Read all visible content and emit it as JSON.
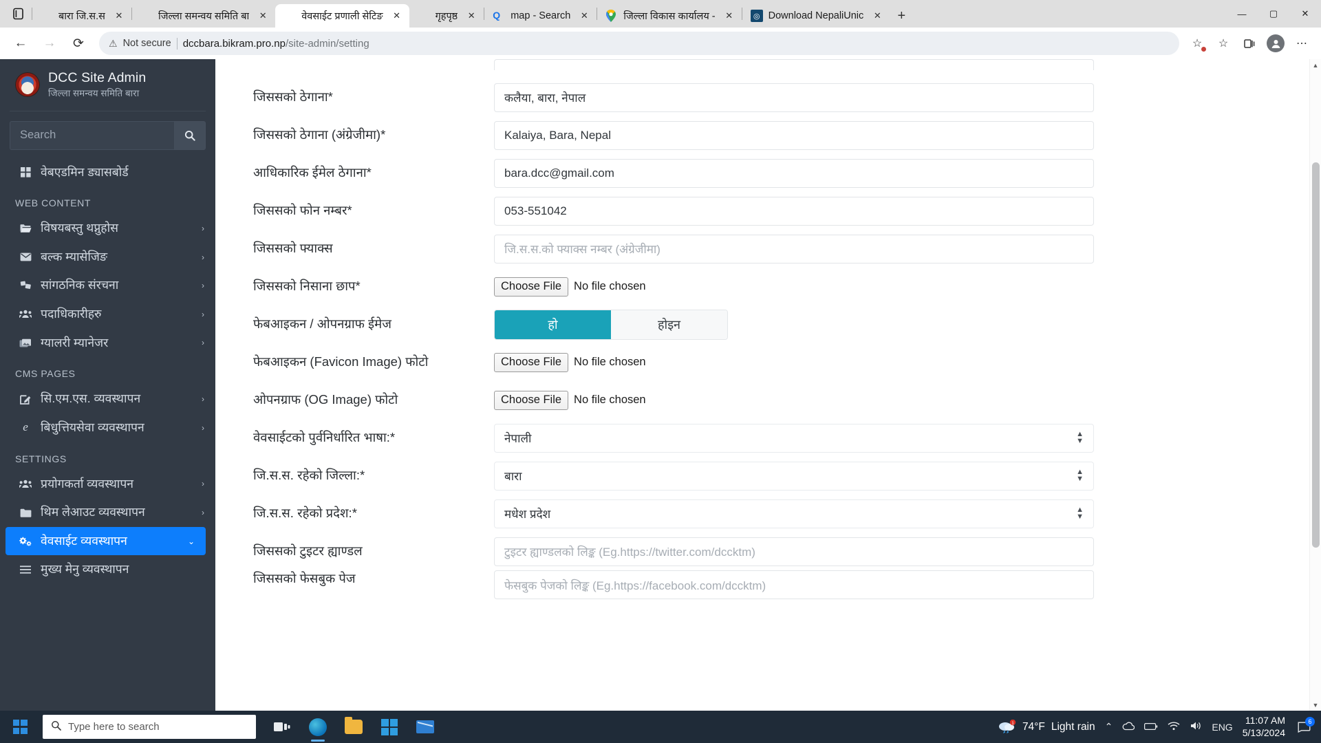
{
  "browser": {
    "tabs": [
      {
        "title": "बारा जि.स.स",
        "icon": "nepal-emblem-icon",
        "active": false
      },
      {
        "title": "जिल्ला समन्वय समिति बा",
        "icon": "nepal-emblem-icon",
        "active": false
      },
      {
        "title": "वेवसाईट प्रणाली सेटिङ",
        "icon": "nepal-emblem-icon",
        "active": true
      },
      {
        "title": "गृहपृष्ठ",
        "icon": "nepal-emblem-icon",
        "active": false
      },
      {
        "title": "map - Search",
        "icon": "bing-search-icon",
        "active": false
      },
      {
        "title": "जिल्ला विकास कार्यालय -",
        "icon": "google-maps-icon",
        "active": false
      },
      {
        "title": "Download NepaliUnic",
        "icon": "download-app-icon",
        "active": false
      }
    ],
    "new_tab_label": "+",
    "close_label": "✕",
    "window_controls": {
      "minimize": "—",
      "maximize": "▢",
      "close": "✕"
    },
    "nav": {
      "back": "←",
      "forward": "→",
      "refresh": "⟳"
    },
    "address": {
      "security_label": "Not secure",
      "url_host": "dccbara.bikram.pro.np",
      "url_path": "/site-admin/setting"
    },
    "toolbar_icons": [
      "add-to-favorites-icon",
      "favorites-icon",
      "collections-icon",
      "profile-icon",
      "settings-and-more-icon"
    ]
  },
  "sidebar": {
    "brand": {
      "title": "DCC Site Admin",
      "subtitle": "जिल्ला समन्वय समिति बारा",
      "logo": "nepal-emblem-logo"
    },
    "search": {
      "placeholder": "Search",
      "button_icon": "search-icon"
    },
    "dashboard": {
      "label": "वेबएडमिन ड्यासबोर्ड",
      "icon": "dashboard-grid-icon"
    },
    "sections": [
      {
        "title": "WEB CONTENT",
        "items": [
          {
            "label": "विषयबस्तु थप्नुहोस",
            "icon": "folder-open-icon",
            "chevron": "›"
          },
          {
            "label": "बल्क म्यासेजिङ",
            "icon": "envelope-icon",
            "chevron": "›"
          },
          {
            "label": "सांगठनिक संरचना",
            "icon": "sitemap-icon",
            "chevron": "›"
          },
          {
            "label": "पदाधिकारीहरु",
            "icon": "users-icon",
            "chevron": "›"
          },
          {
            "label": "ग्यालरी म्यानेजर",
            "icon": "images-icon",
            "chevron": "›"
          }
        ]
      },
      {
        "title": "CMS PAGES",
        "items": [
          {
            "label": "सि.एम.एस. व्यवस्थापन",
            "icon": "edit-square-icon",
            "chevron": "›"
          },
          {
            "label": "बिधुत्तियसेवा व्यवस्थापन",
            "icon": "internet-explorer-icon",
            "chevron": "›"
          }
        ]
      },
      {
        "title": "SETTINGS",
        "items": [
          {
            "label": "प्रयोगकर्ता व्यवस्थापन",
            "icon": "users-icon",
            "chevron": "›"
          },
          {
            "label": "थिम लेआउट व्यवस्थापन",
            "icon": "folder-icon",
            "chevron": "›"
          },
          {
            "label": "वेवसाईट व्यवस्थापन",
            "icon": "gears-icon",
            "chevron": "⌄",
            "active": true
          },
          {
            "label": "मुख्य मेनु व्यवस्थापन",
            "icon": "list-icon",
            "chevron": ""
          }
        ]
      }
    ],
    "active_color": "#0d7efc",
    "background_color": "#323a45"
  },
  "form": {
    "rows": [
      {
        "type": "input-cut",
        "label": "",
        "value": ""
      },
      {
        "type": "input",
        "label": "जिससको ठेगाना*",
        "value": "कलैया, बारा, नेपाल"
      },
      {
        "type": "input",
        "label": "जिससको ठेगाना (अंग्रेजीमा)*",
        "value": "Kalaiya, Bara, Nepal"
      },
      {
        "type": "input",
        "label": "आधिकारिक ईमेल ठेगाना*",
        "value": "bara.dcc@gmail.com"
      },
      {
        "type": "input",
        "label": "जिससको फोन नम्बर*",
        "value": "053-551042"
      },
      {
        "type": "input",
        "label": "जिससको फ्याक्स",
        "value": "",
        "placeholder": "जि.स.स.को फ्याक्स नम्बर (अंग्रेजीमा)"
      },
      {
        "type": "file",
        "label": "जिससको निसाना छाप*",
        "button": "Choose File",
        "status": "No file chosen"
      },
      {
        "type": "toggle",
        "label": "फेबआइकन / ओपनग्राफ ईमेज",
        "options": [
          "हो",
          "होइन"
        ],
        "selected": 0
      },
      {
        "type": "file",
        "label": "फेबआइकन (Favicon Image) फोटो",
        "button": "Choose File",
        "status": "No file chosen"
      },
      {
        "type": "file",
        "label": "ओपनग्राफ (OG Image) फोटो",
        "button": "Choose File",
        "status": "No file chosen"
      },
      {
        "type": "select",
        "label": "वेवसाईटको पुर्वनिर्धारित भाषा:*",
        "value": "नेपाली"
      },
      {
        "type": "select",
        "label": "जि.स.स. रहेको जिल्ला:*",
        "value": "बारा"
      },
      {
        "type": "select",
        "label": "जि.स.स. रहेको प्रदेश:*",
        "value": "मधेश प्रदेश"
      },
      {
        "type": "input",
        "label": "जिससको टुइटर ह्याण्डल",
        "value": "",
        "placeholder": "टुइटर ह्याण्डलको लिङ्क (Eg.https://twitter.com/dccktm)"
      },
      {
        "type": "input",
        "label": "जिससको फेसबुक पेज",
        "value": "",
        "placeholder": "फेसबुक पेजको लिङ्क (Eg.https://facebook.com/dccktm)"
      }
    ],
    "toggle_selected_color": "#1aa2b8"
  },
  "taskbar": {
    "search_placeholder": "Type here to search",
    "search_icon": "search-icon",
    "start_icon": "windows-start-icon",
    "apps": [
      {
        "name": "task-view-icon"
      },
      {
        "name": "microsoft-edge-icon"
      },
      {
        "name": "file-explorer-icon"
      },
      {
        "name": "microsoft-store-icon"
      },
      {
        "name": "mail-icon"
      }
    ],
    "weather": {
      "temperature": "74°F",
      "condition": "Light rain",
      "icon": "rain-cloud-icon",
      "badge": "1"
    },
    "tray_icons": [
      "show-hidden-icons-chevron",
      "onedrive-icon",
      "battery-icon",
      "wifi-icon",
      "volume-icon"
    ],
    "language": "ENG",
    "time": "11:07 AM",
    "date": "5/13/2024",
    "notification_count": "6"
  }
}
